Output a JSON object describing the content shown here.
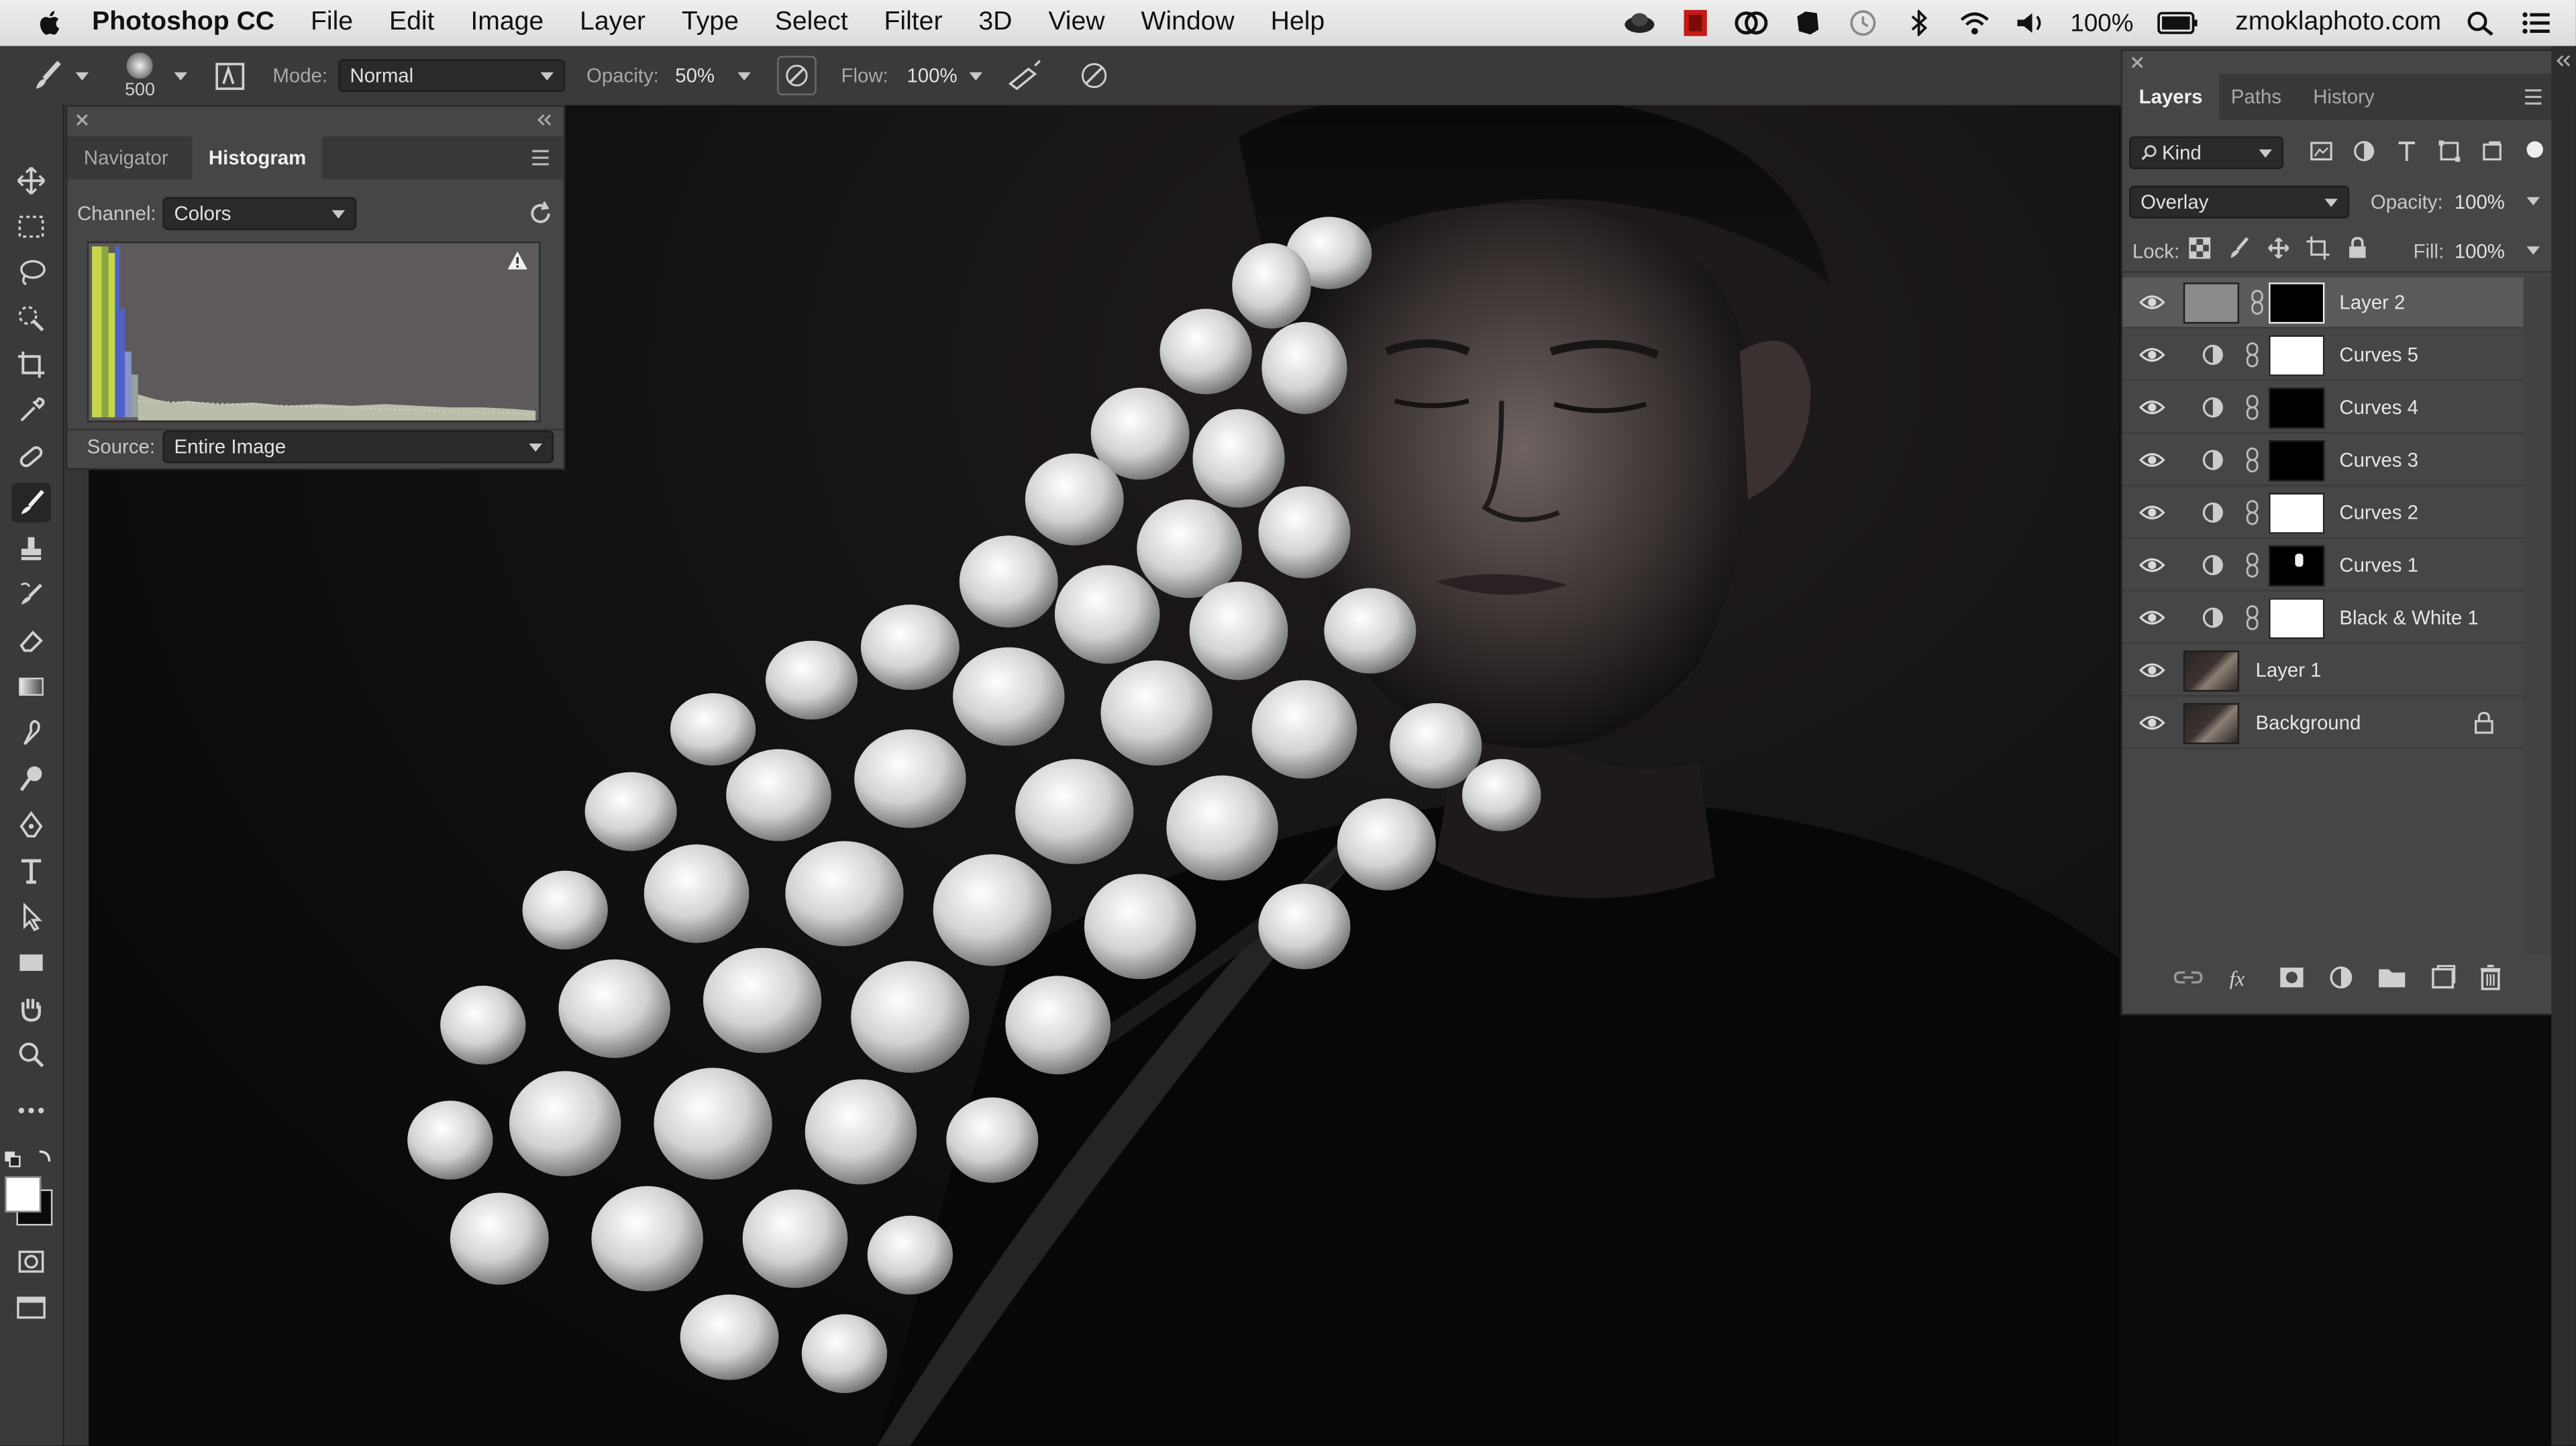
{
  "menubar": {
    "app_name": "Photoshop CC",
    "menus": [
      "File",
      "Edit",
      "Image",
      "Layer",
      "Type",
      "Select",
      "Filter",
      "3D",
      "View",
      "Window",
      "Help"
    ],
    "battery": "100%",
    "site": "zmoklaphoto.com"
  },
  "options_bar": {
    "brush_size": "500",
    "mode_label": "Mode:",
    "mode_value": "Normal",
    "opacity_label": "Opacity:",
    "opacity_value": "50%",
    "flow_label": "Flow:",
    "flow_value": "100%"
  },
  "histogram_panel": {
    "tabs": [
      "Navigator",
      "Histogram"
    ],
    "active_tab": "Histogram",
    "channel_label": "Channel:",
    "channel_value": "Colors",
    "source_label": "Source:",
    "source_value": "Entire Image"
  },
  "layers_panel": {
    "tabs": [
      "Layers",
      "Paths",
      "History"
    ],
    "active_tab": "Layers",
    "filter_kind": "Kind",
    "blend_mode": "Overlay",
    "opacity_label": "Opacity:",
    "opacity_value": "100%",
    "lock_label": "Lock:",
    "fill_label": "Fill:",
    "fill_value": "100%",
    "layers": [
      {
        "name": "Layer 2",
        "type": "pixel-with-mask",
        "selected": true
      },
      {
        "name": "Curves 5",
        "type": "adjustment",
        "mask": "white"
      },
      {
        "name": "Curves 4",
        "type": "adjustment",
        "mask": "black"
      },
      {
        "name": "Curves 3",
        "type": "adjustment",
        "mask": "black"
      },
      {
        "name": "Curves 2",
        "type": "adjustment",
        "mask": "white"
      },
      {
        "name": "Curves 1",
        "type": "adjustment",
        "mask": "black"
      },
      {
        "name": "Black & White 1",
        "type": "adjustment",
        "mask": "white"
      },
      {
        "name": "Layer 1",
        "type": "pixel"
      },
      {
        "name": "Background",
        "type": "background",
        "locked": true
      }
    ]
  },
  "colors": {
    "panel_bg": "#464646",
    "chrome_bg": "#3a3a3a",
    "selected_row": "#5a5a5a"
  }
}
